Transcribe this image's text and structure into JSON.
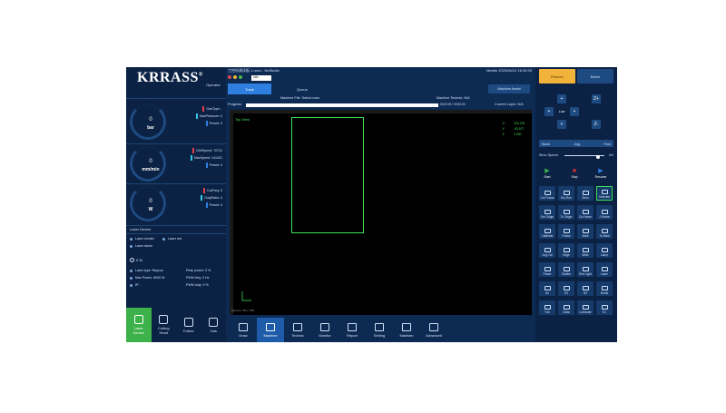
{
  "brand": {
    "logo": "KRRASS",
    "logo_mark": "®",
    "role": "Operator"
  },
  "gauges": [
    {
      "value": "0",
      "unit": "bar",
      "metrics": [
        {
          "label": "GasType: -",
          "color": "#e0404a"
        },
        {
          "label": "MaxPressure: 0",
          "color": "#35c7e8"
        },
        {
          "label": "Preset: 0",
          "color": "#2f7fe0"
        }
      ]
    },
    {
      "value": "0",
      "unit": "mm/min",
      "metrics": [
        {
          "label": "G00Speed: 70711",
          "color": "#e0404a"
        },
        {
          "label": "MaxSpeed: 141421",
          "color": "#35c7e8"
        },
        {
          "label": "Preset: 0",
          "color": "#2f7fe0"
        }
      ]
    },
    {
      "value": "0",
      "unit": "W",
      "metrics": [
        {
          "label": "CutFreq: 0",
          "color": "#e0404a"
        },
        {
          "label": "DutyRatio: 0",
          "color": "#35c7e8"
        },
        {
          "label": "Preset: 0",
          "color": "#2f7fe0"
        }
      ]
    }
  ],
  "laser_device": {
    "title": "Laser Device",
    "shutter": "Laser shutter",
    "red": "Laser red",
    "alarm": "Laser alarm",
    "power": "0 W",
    "type": "Laser type:  Raycus",
    "max_power": "Max Power: 6000 W",
    "ip": "IP: -",
    "peak_power": "Peak power: 0 %",
    "pwm_freq": "PWM freq: 0 Hz",
    "pwm_duty": "PWM duty: 0 %"
  },
  "left_tabs": [
    {
      "label": "Laser\nDevice",
      "active": true
    },
    {
      "label": "Cutting\nHead",
      "active": false
    },
    {
      "label": "Follow",
      "active": false
    },
    {
      "label": "Gas",
      "active": false
    }
  ],
  "window": {
    "title": "工控机调试板 1.ncex - NcStudio",
    "right": "Nimble  2020/06/12  16:39:35",
    "status": "Idle"
  },
  "center_tabs": {
    "track": "Track",
    "queue": "Queue",
    "assist": "Machine Assist"
  },
  "info": {
    "file": "Machine File:  Select.ncex",
    "technic": "Machine Technic:  N/A"
  },
  "progress": {
    "label": "Progress",
    "percent": 0,
    "time": "00:00:00 / 00:00:00",
    "layer": "Current Layer:  N/A"
  },
  "canvas": {
    "view": "Top View",
    "coords": [
      {
        "axis": "X:",
        "value": "324.725"
      },
      {
        "axis": "Y:",
        "value": "-83.107"
      },
      {
        "axis": "Z:",
        "value": "0.000"
      }
    ],
    "memory": "Memory: 2M / 72M"
  },
  "bottom_tabs": [
    "Draw",
    "Machine",
    "Technic",
    "Monitor",
    "Report",
    "Setting",
    "Maintain",
    "Advanced"
  ],
  "bottom_active": "Machine",
  "right": {
    "restore": "Restore",
    "batch": "Batch",
    "jog": {
      "up": "+",
      "left": "+",
      "right": "+",
      "down": "+",
      "speed": "Low",
      "z_up": "Z+",
      "z_down": "Z-"
    },
    "speed_bar": {
      "back": "Back",
      "mode": "Jog",
      "fwd": "Fwd"
    },
    "simu": {
      "label": "Simu Speed",
      "value": "4/4",
      "fraction": 0.85
    },
    "controls": [
      {
        "label": "Start",
        "color": "#3db24a"
      },
      {
        "label": "Stop",
        "color": "#c0303a"
      },
      {
        "label": "Resume",
        "color": "#2f7fe0"
      }
    ],
    "grid": [
      [
        "Cut Frame",
        "Dry Run",
        "Simu",
        "Selected"
      ],
      [
        "Set Origin",
        "To Origin",
        "Go Home",
        "Z Home"
      ],
      [
        "Calibrate",
        "Follow",
        "Mark",
        "To Mark"
      ],
      [
        "Jog Cut",
        "Edge",
        "Wide",
        "Lamp"
      ],
      [
        "Power",
        "Shutter",
        "Red Light",
        "Laser"
      ],
      [
        "Air",
        "O2",
        "N2",
        "Boost"
      ],
      [
        "Fan",
        "Clean",
        "Lubricate",
        "K1"
      ]
    ]
  }
}
